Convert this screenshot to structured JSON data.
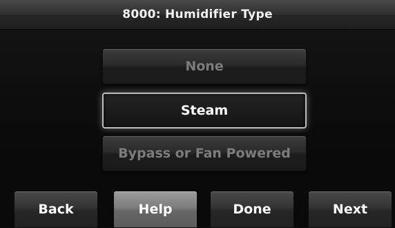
{
  "header": {
    "title": "8000: Humidifier Type"
  },
  "options": [
    {
      "label": "None",
      "state": "unselected"
    },
    {
      "label": "Steam",
      "state": "selected"
    },
    {
      "label": "Bypass or Fan Powered",
      "state": "unselected"
    }
  ],
  "nav": {
    "back_label": "Back",
    "help_label": "Help",
    "done_label": "Done",
    "next_label": "Next"
  },
  "colors": {
    "selected_text": "#ffffff",
    "unselected_text": "#7c7c7c",
    "selection_border": "#bdbdbd",
    "help_button_face": "#7c7c7c"
  }
}
